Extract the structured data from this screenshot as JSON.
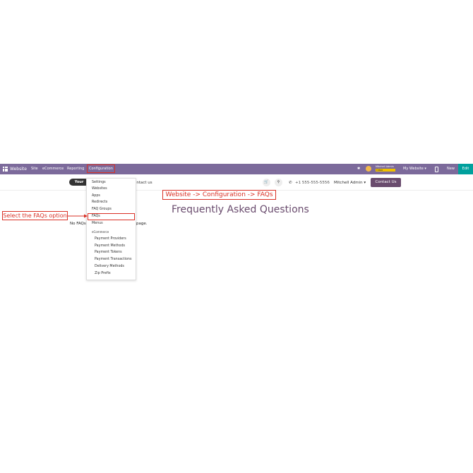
{
  "navbar": {
    "app_title": "Website",
    "menu": [
      "Site",
      "eCommerce",
      "Reporting",
      "Configuration"
    ],
    "user_name": "Mitchell Admin",
    "user_db": "Odoo",
    "website_selector": "My Website",
    "new_label": "New",
    "edit_label": "Edit",
    "colors": {
      "bar": "#7c6a9b",
      "edit": "#00a09d"
    }
  },
  "site_header": {
    "logo_text": "Your",
    "nav_link": "ontact us",
    "phone": "+1 555-555-5556",
    "user_menu": "Mitchell Admin",
    "contact_button": "Contact Us"
  },
  "dropdown": {
    "items": [
      "Settings",
      "Websites",
      "Apps",
      "Redirects",
      "FAQ Groups",
      "FAQs",
      "Menus"
    ],
    "section_label": "eCommerce",
    "ecommerce_items": [
      "Payment Providers",
      "Payment Methods",
      "Payment Tokens",
      "Payment Transactions",
      "Delivery Methods",
      "Zip Prefix"
    ]
  },
  "content": {
    "title": "Frequently Asked Questions",
    "empty_text_left": "No FAQs",
    "empty_text_right": "page."
  },
  "annotations": {
    "path_note": "Website -> Configuration -> FAQs",
    "select_note": "Select the FAQs option"
  }
}
